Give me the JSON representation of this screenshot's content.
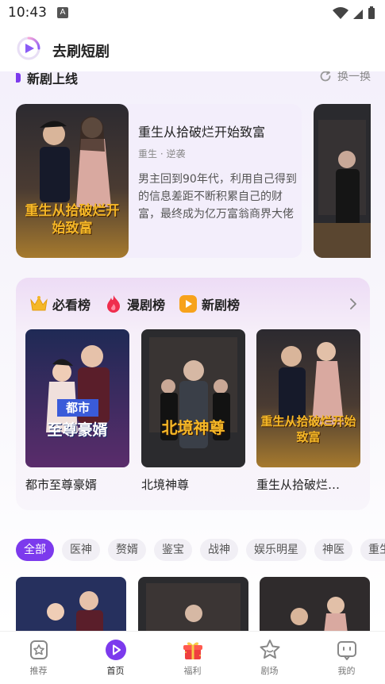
{
  "status": {
    "time": "10:43",
    "indicator": "A"
  },
  "app": {
    "title": "去刷短剧"
  },
  "section": {
    "title": "新剧上线",
    "refresh_label": "换一换"
  },
  "feature": {
    "title": "重生从拾破烂开始致富",
    "tags": "重生 · 逆袭",
    "desc": "男主回到90年代，利用自己得到的信息差距不断积累自己的财富，最终成为亿万富翁商界大佬",
    "poster_text": "重生从拾破烂开始致富"
  },
  "rank": {
    "tabs": [
      {
        "label": "必看榜",
        "icon": "crown-icon"
      },
      {
        "label": "漫剧榜",
        "icon": "flame-icon"
      },
      {
        "label": "新剧榜",
        "icon": "play-badge-icon"
      }
    ],
    "items": [
      {
        "name": "都市至尊豪婿",
        "poster_text_1": "都市",
        "poster_text_2": "至尊豪婿"
      },
      {
        "name": "北境神尊",
        "poster_text_1": "北境神尊"
      },
      {
        "name": "重生从拾破烂…",
        "poster_text_1": "重生从拾破烂开始致富"
      }
    ]
  },
  "categories": [
    "全部",
    "医神",
    "赘婿",
    "鉴宝",
    "战神",
    "娱乐明星",
    "神医",
    "重生"
  ],
  "tabs": [
    {
      "label": "推荐",
      "icon": "star-badge-icon"
    },
    {
      "label": "首页",
      "icon": "play-circle-icon"
    },
    {
      "label": "福利",
      "icon": "gift-icon"
    },
    {
      "label": "剧场",
      "icon": "star-outline-icon"
    },
    {
      "label": "我的",
      "icon": "profile-icon"
    }
  ],
  "colors": {
    "accent": "#7c3aed",
    "background": "#f4f0fb"
  }
}
